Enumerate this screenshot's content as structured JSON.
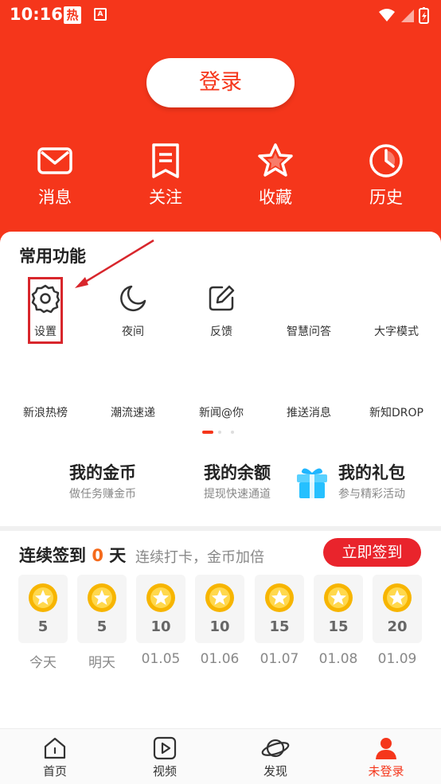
{
  "status_bar": {
    "time": "10:16",
    "hot_badge": "热",
    "a_badge": "A"
  },
  "header": {
    "login_label": "登录",
    "quick": [
      {
        "label": "消息",
        "icon": "mail-icon"
      },
      {
        "label": "关注",
        "icon": "bookmark-icon"
      },
      {
        "label": "收藏",
        "icon": "star-icon"
      },
      {
        "label": "历史",
        "icon": "clock-icon"
      }
    ]
  },
  "common": {
    "title": "常用功能",
    "row1": [
      "设置",
      "夜间",
      "反馈",
      "智慧问答",
      "大字模式"
    ],
    "row2": [
      "新浪热榜",
      "潮流速递",
      "新闻@你",
      "推送消息",
      "新知DROP"
    ]
  },
  "bank": [
    {
      "title": "我的金币",
      "sub": "做任务赚金币"
    },
    {
      "title": "我的余额",
      "sub": "提现快速通道"
    },
    {
      "title": "我的礼包",
      "sub": "参与精彩活动"
    }
  ],
  "signin": {
    "title_prefix": "连续签到",
    "days": "0",
    "title_suffix": "天",
    "sub": "连续打卡，金币加倍",
    "button": "立即签到",
    "cards": [
      {
        "value": "5",
        "label": "今天"
      },
      {
        "value": "5",
        "label": "明天"
      },
      {
        "value": "10",
        "label": "01.05"
      },
      {
        "value": "10",
        "label": "01.06"
      },
      {
        "value": "15",
        "label": "01.07"
      },
      {
        "value": "15",
        "label": "01.08"
      },
      {
        "value": "20",
        "label": "01.09"
      }
    ]
  },
  "tabbar": [
    {
      "label": "首页",
      "icon": "home-icon"
    },
    {
      "label": "视频",
      "icon": "video-icon"
    },
    {
      "label": "发现",
      "icon": "planet-icon"
    },
    {
      "label": "未登录",
      "icon": "user-icon"
    }
  ],
  "colors": {
    "brand": "#f5361b",
    "accent": "#e9242c",
    "highlight": "#d8262c",
    "coin": "#f7b500"
  }
}
